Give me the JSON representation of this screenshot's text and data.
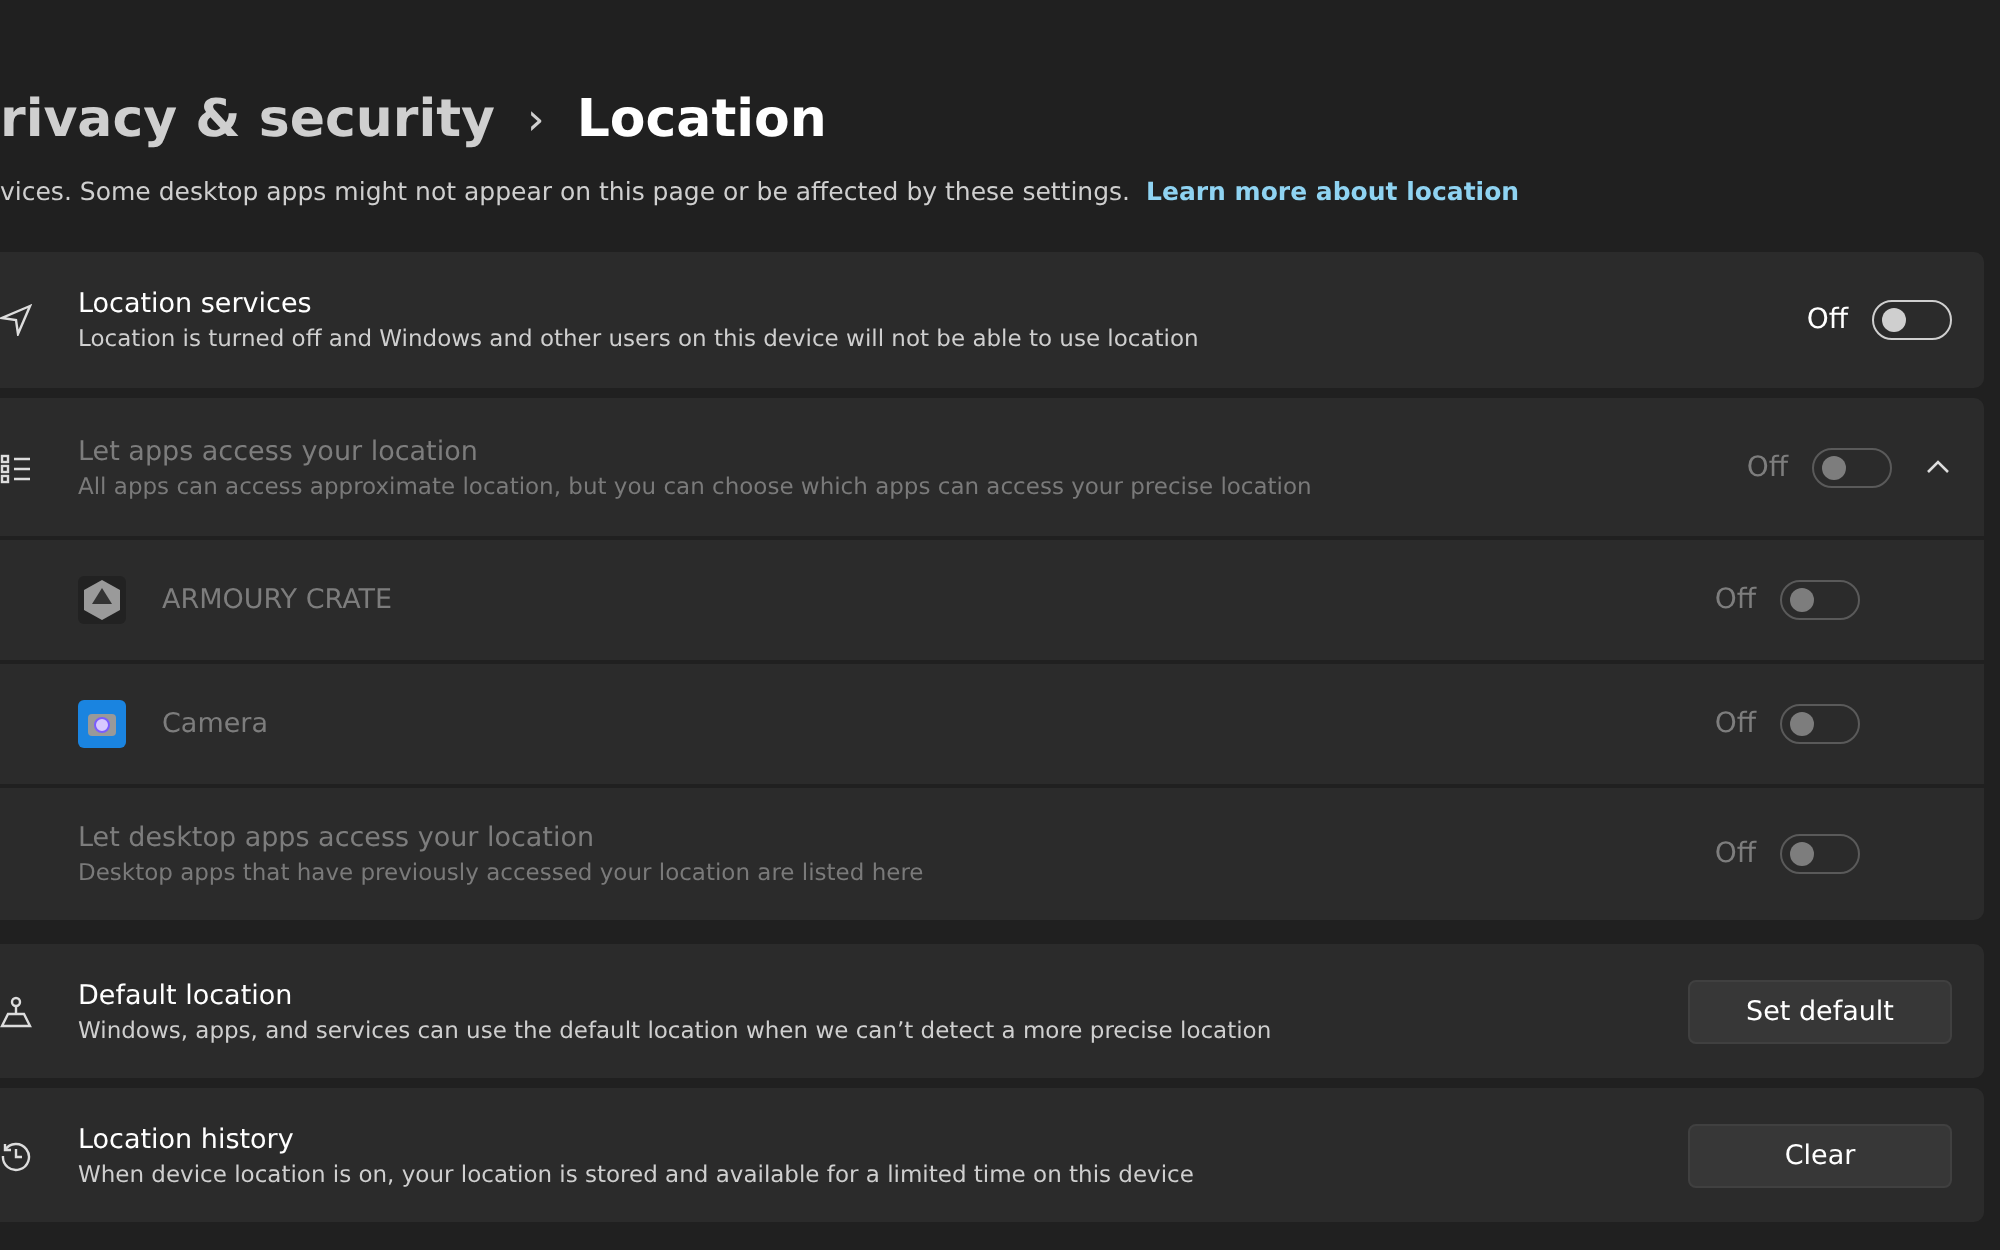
{
  "breadcrumb": {
    "parent": "rivacy & security",
    "separator": "›",
    "current": "Location"
  },
  "description": {
    "text": "vices. Some desktop apps might not appear on this page or be affected by these settings.",
    "link": "Learn more about location"
  },
  "location_services": {
    "title": "Location services",
    "subtitle": "Location is turned off and Windows and other users on this device will not be able to use location",
    "state_label": "Off",
    "on": false,
    "disabled": false
  },
  "app_access": {
    "title": "Let apps access your location",
    "subtitle": "All apps can access approximate location, but you can choose which apps can access your precise location",
    "state_label": "Off",
    "on": false,
    "disabled": true,
    "expanded": true,
    "children": [
      {
        "kind": "crate",
        "title": "ARMOURY CRATE",
        "state_label": "Off",
        "on": false,
        "disabled": true
      },
      {
        "kind": "camera",
        "title": "Camera",
        "state_label": "Off",
        "on": false,
        "disabled": true
      },
      {
        "kind": "desktop",
        "title": "Let desktop apps access your location",
        "subtitle": "Desktop apps that have previously accessed your location are listed here",
        "state_label": "Off",
        "on": false,
        "disabled": true
      }
    ]
  },
  "default_location": {
    "title": "Default location",
    "subtitle": "Windows, apps, and services can use the default location when we can’t detect a more precise location",
    "button": "Set default"
  },
  "location_history": {
    "title": "Location history",
    "subtitle": "When device location is on, your location is stored and available for a limited time on this device",
    "button": "Clear"
  }
}
